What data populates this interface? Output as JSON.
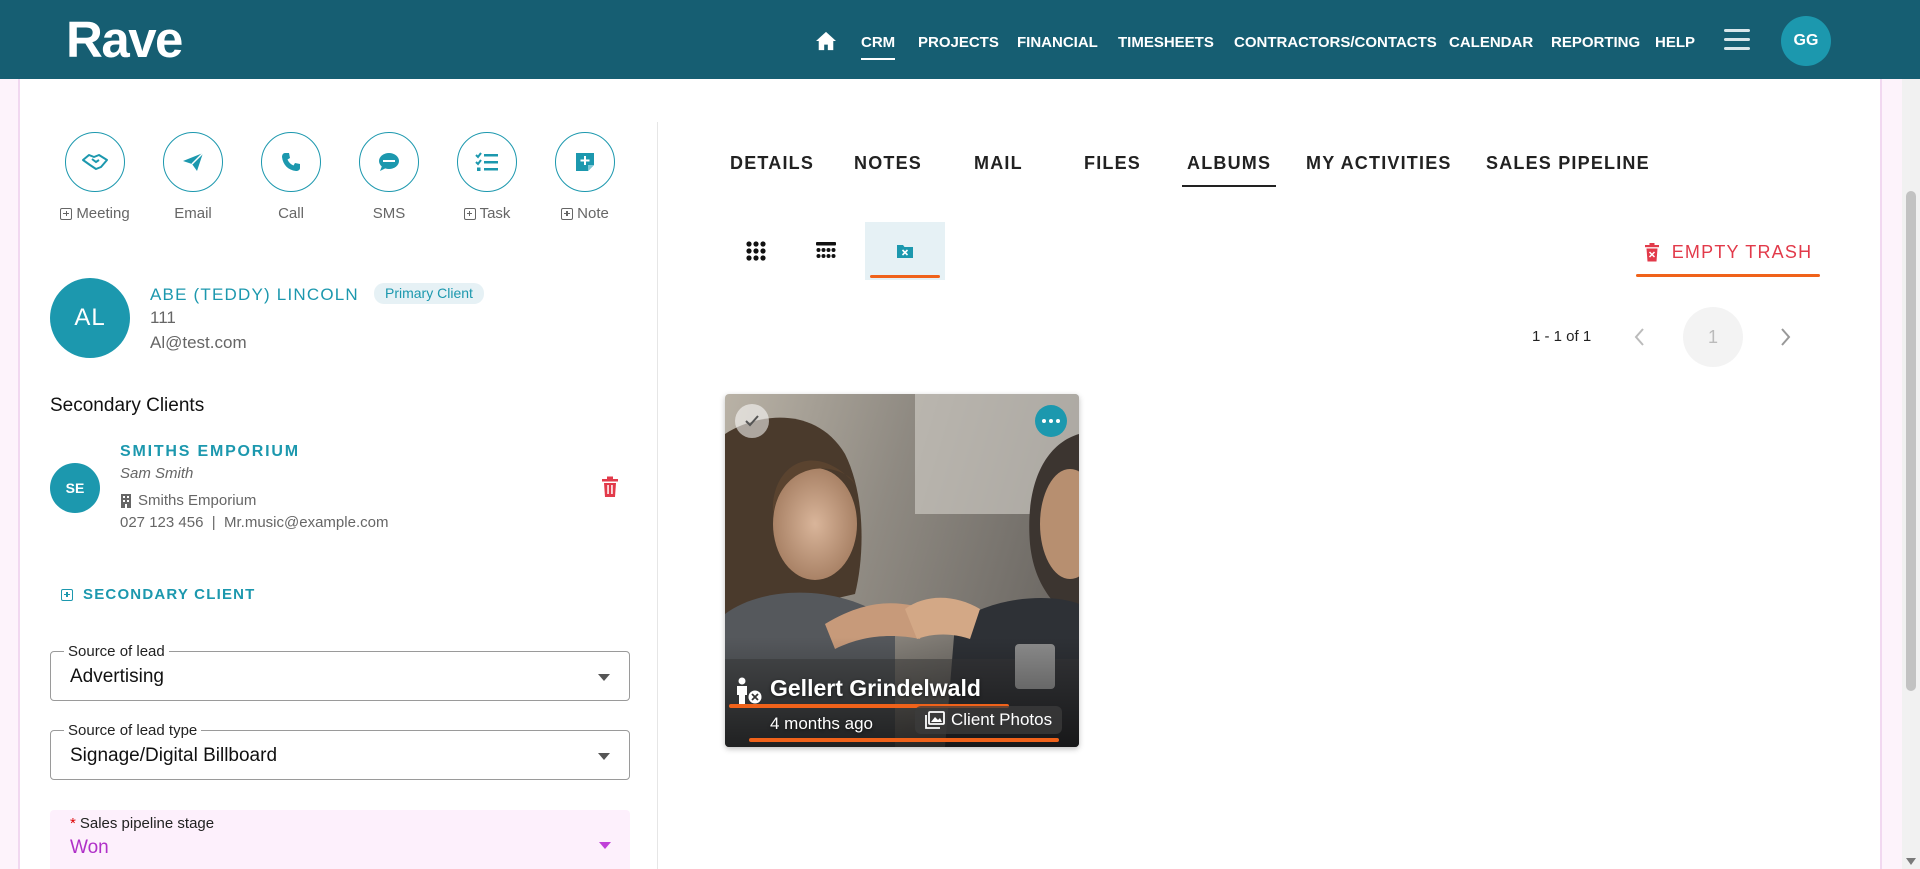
{
  "header": {
    "logo": "Rave",
    "nav": [
      "CRM",
      "PROJECTS",
      "FINANCIAL",
      "TIMESHEETS",
      "CONTRACTORS/CONTACTS",
      "CALENDAR",
      "REPORTING",
      "HELP"
    ],
    "active_nav": "CRM",
    "user_initials": "GG",
    "icons": [
      "home-icon",
      "hamburger-menu-icon"
    ]
  },
  "quick_actions": [
    {
      "label": "Meeting",
      "icon": "handshake-icon",
      "has_plus": true
    },
    {
      "label": "Email",
      "icon": "paper-plane-icon",
      "has_plus": false
    },
    {
      "label": "Call",
      "icon": "phone-icon",
      "has_plus": false
    },
    {
      "label": "SMS",
      "icon": "sms-bubble-icon",
      "has_plus": false
    },
    {
      "label": "Task",
      "icon": "checklist-icon",
      "has_plus": true
    },
    {
      "label": "Note",
      "icon": "note-plus-icon",
      "has_plus": true
    }
  ],
  "primary_client": {
    "initials": "AL",
    "name": "ABE (TEDDY) LINCOLN",
    "badge": "Primary Client",
    "phone": "111",
    "email": "Al@test.com"
  },
  "secondary": {
    "title": "Secondary Clients",
    "clients": [
      {
        "initials": "SE",
        "name": "SMITHS EMPORIUM",
        "contact": "Sam Smith",
        "company": "Smiths Emporium",
        "phone": "027 123 456",
        "separator": "|",
        "email": "Mr.music@example.com"
      }
    ],
    "add_label": "SECONDARY CLIENT"
  },
  "fields": {
    "source_of_lead": {
      "label": "Source of lead",
      "value": "Advertising"
    },
    "source_of_lead_type": {
      "label": "Source of lead type",
      "value": "Signage/Digital Billboard"
    },
    "sales_pipeline_stage": {
      "required_mark": "*",
      "label": "Sales pipeline stage",
      "value": "Won"
    }
  },
  "tabs": [
    "DETAILS",
    "NOTES",
    "MAIL",
    "FILES",
    "ALBUMS",
    "MY ACTIVITIES",
    "SALES PIPELINE"
  ],
  "active_tab": "ALBUMS",
  "view_toggles": [
    "grid-large-icon",
    "grid-list-icon",
    "trash-folder-icon"
  ],
  "empty_trash_label": "EMPTY TRASH",
  "pagination": {
    "range": "1 - 1 of 1",
    "page": "1"
  },
  "album": {
    "title": "Gellert Grindelwald",
    "date": "4 months ago",
    "tag": "Client Photos"
  },
  "colors": {
    "header_bg": "#165e72",
    "accent": "#1c98ae",
    "danger": "#e23a4a",
    "highlight": "#f0621a",
    "pipeline_value": "#b030c8"
  }
}
